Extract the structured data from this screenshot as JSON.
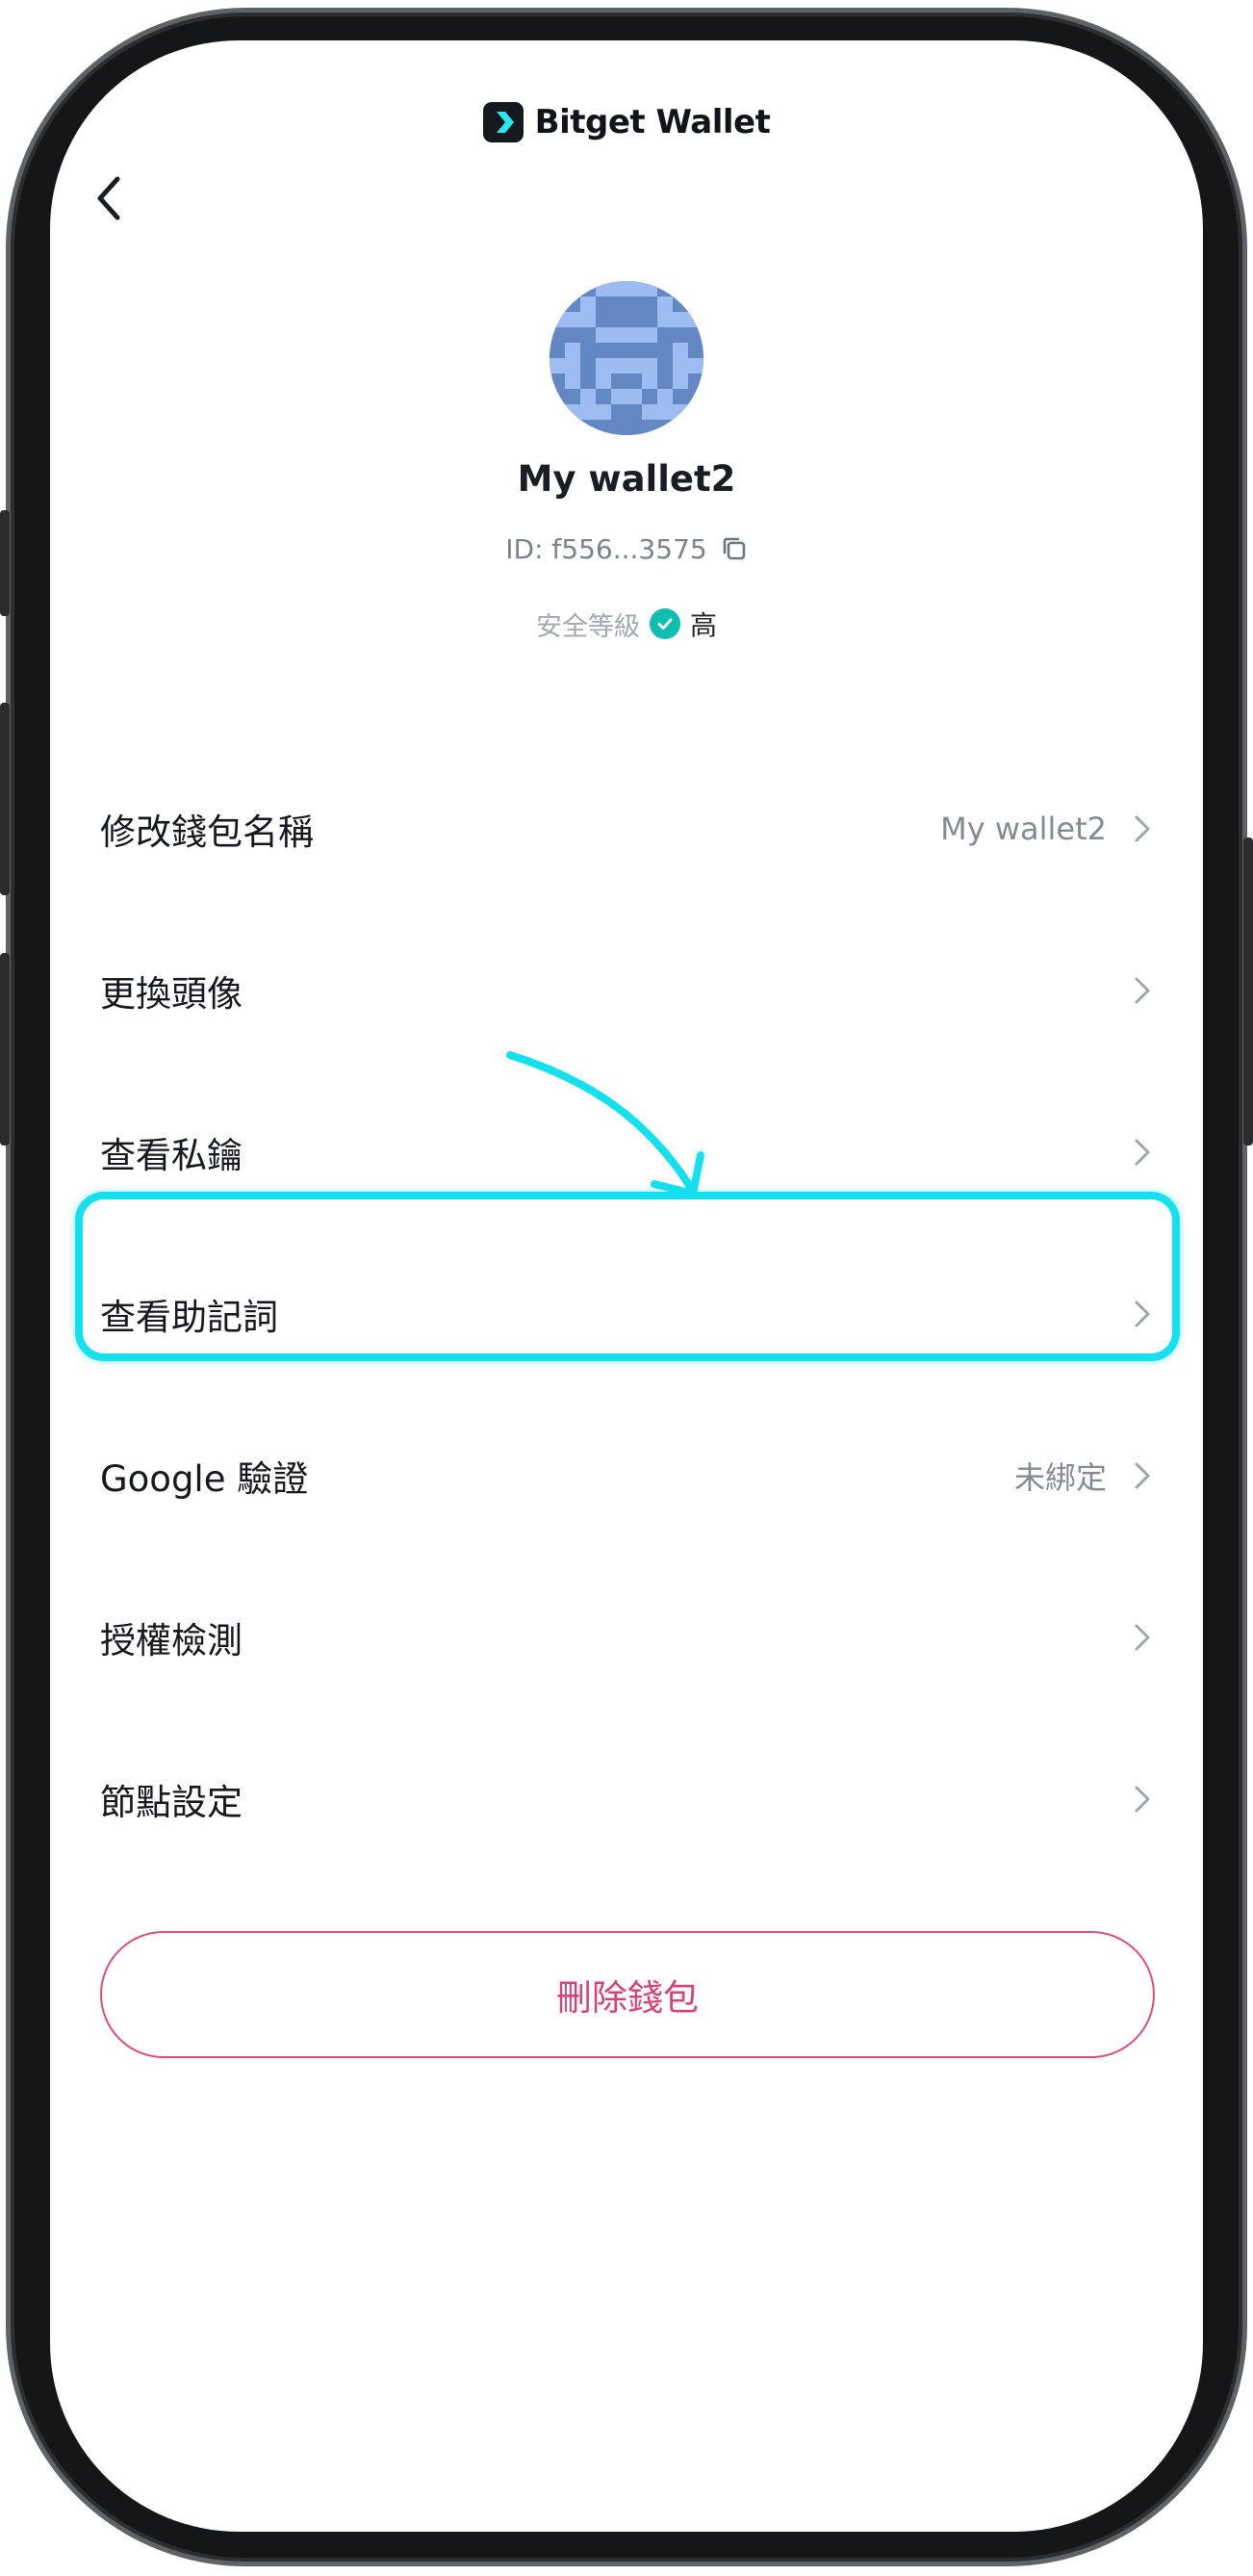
{
  "brand": {
    "name": "Bitget Wallet"
  },
  "profile": {
    "wallet_name": "My wallet2",
    "wallet_id": "ID: f556...3575",
    "security_label": "安全等級",
    "security_level": "高"
  },
  "menu": {
    "items": [
      {
        "label": "修改錢包名稱",
        "value": "My wallet2"
      },
      {
        "label": "更換頭像",
        "value": ""
      },
      {
        "label": "查看私鑰",
        "value": ""
      },
      {
        "label": "查看助記詞",
        "value": ""
      },
      {
        "label": "Google 驗證",
        "value": "未綁定"
      },
      {
        "label": "授權檢測",
        "value": ""
      },
      {
        "label": "節點設定",
        "value": ""
      }
    ]
  },
  "actions": {
    "delete_label": "刪除錢包"
  },
  "colors": {
    "accent_danger": "#d7417a",
    "highlight": "#14e0ee",
    "security_check": "#0ebfb0",
    "avatar_light": "#9dbcf2",
    "avatar_dark": "#6287c3"
  },
  "icons": {
    "back": "chevron-left-icon",
    "copy": "copy-icon",
    "check": "check-icon",
    "row_chevron": "chevron-right-icon"
  }
}
